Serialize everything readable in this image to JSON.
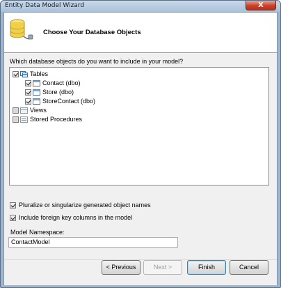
{
  "window": {
    "title": "Entity Data Model Wizard",
    "close_glyph": "X"
  },
  "header": {
    "title": "Choose Your Database Objects",
    "icon": "database-connection-icon"
  },
  "question": "Which database objects do you want to include in your model?",
  "tree": {
    "items": [
      {
        "label": "Tables",
        "checked": true,
        "icon": "tables-icon"
      },
      {
        "label": "Contact (dbo)",
        "checked": true,
        "icon": "table-icon"
      },
      {
        "label": "Store (dbo)",
        "checked": true,
        "icon": "table-icon"
      },
      {
        "label": "StoreContact (dbo)",
        "checked": true,
        "icon": "table-icon"
      },
      {
        "label": "Views",
        "checked": false,
        "icon": "views-icon"
      },
      {
        "label": "Stored Procedures",
        "checked": false,
        "icon": "stored-procedures-icon"
      }
    ]
  },
  "options": {
    "pluralize": {
      "label": "Pluralize or singularize generated object names",
      "checked": true
    },
    "foreign_keys": {
      "label": "Include foreign key columns in the model",
      "checked": true
    }
  },
  "namespace": {
    "label": "Model Namespace:",
    "value": "ContactModel"
  },
  "buttons": {
    "previous": "< Previous",
    "next": "Next >",
    "finish": "Finish",
    "cancel": "Cancel"
  }
}
